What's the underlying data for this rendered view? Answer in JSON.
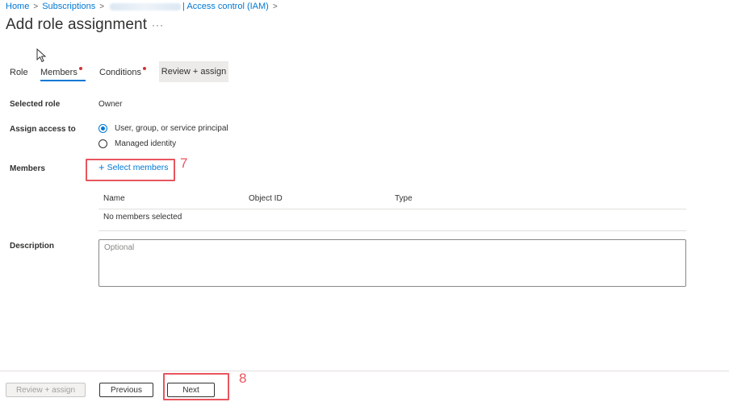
{
  "breadcrumb": {
    "home": "Home",
    "subscriptions": "Subscriptions",
    "access_control": "| Access control (IAM)"
  },
  "page": {
    "title": "Add role assignment",
    "more": "···"
  },
  "tabs": [
    {
      "label": "Role"
    },
    {
      "label": "Members",
      "active": true,
      "required": true
    },
    {
      "label": "Conditions",
      "required": true
    },
    {
      "label": "Review + assign"
    }
  ],
  "form": {
    "selected_role_label": "Selected role",
    "selected_role_value": "Owner",
    "assign_access_label": "Assign access to",
    "assign_options": [
      {
        "label": "User, group, or service principal",
        "checked": true
      },
      {
        "label": "Managed identity",
        "checked": false
      }
    ],
    "members_label": "Members",
    "select_members": "Select members",
    "select_members_plus": "+",
    "members_table": {
      "columns": [
        "Name",
        "Object ID",
        "Type"
      ],
      "empty_text": "No members selected"
    },
    "description_label": "Description",
    "description_placeholder": "Optional",
    "description_value": ""
  },
  "annotations": {
    "step7": "7",
    "step8": "8",
    "color": "#e8555f"
  },
  "footer": {
    "review_assign": "Review + assign",
    "previous": "Previous",
    "next": "Next"
  },
  "colors": {
    "accent": "#0078d4",
    "required_dot": "#d13438"
  }
}
